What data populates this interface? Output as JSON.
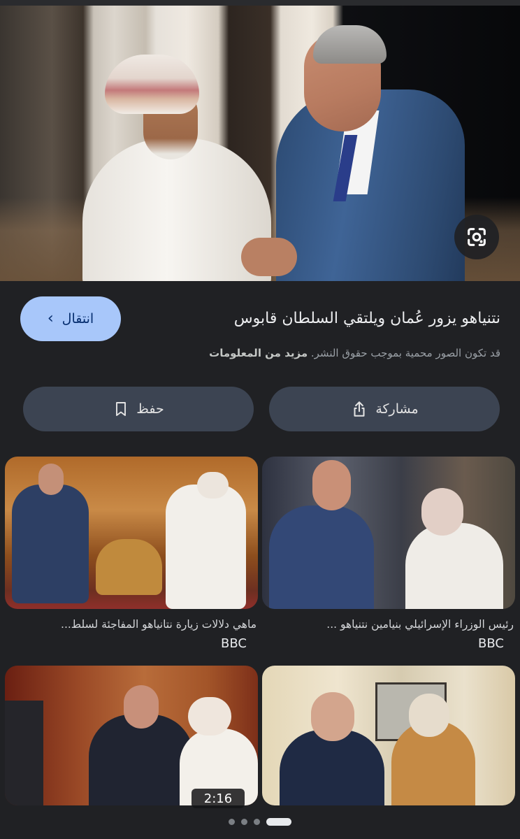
{
  "result": {
    "title": "نتنياهو يزور عُمان ويلتقي السلطان قابوس",
    "visit_label": "انتقال",
    "copyright_notice": "قد تكون الصور محمية بموجب حقوق النشر.",
    "more_info_label": "مزيد من المعلومات",
    "share_label": "مشاركة",
    "save_label": "حفظ"
  },
  "related": [
    {
      "caption": "رئيس الوزراء الإسرائيلي بنيامين نتنياهو ...",
      "source": "BBC"
    },
    {
      "caption": "ماهي دلالات زيارة نتانياهو المفاجئة لسلط...",
      "source": "BBC"
    },
    {
      "caption": "",
      "source": "",
      "duration": "2:16"
    },
    {
      "caption": "",
      "source": ""
    }
  ],
  "pager": {
    "count": 4,
    "active_index": 3
  },
  "colors": {
    "accent": "#a8c7fa",
    "pill": "#3c4452",
    "background": "#202124"
  }
}
